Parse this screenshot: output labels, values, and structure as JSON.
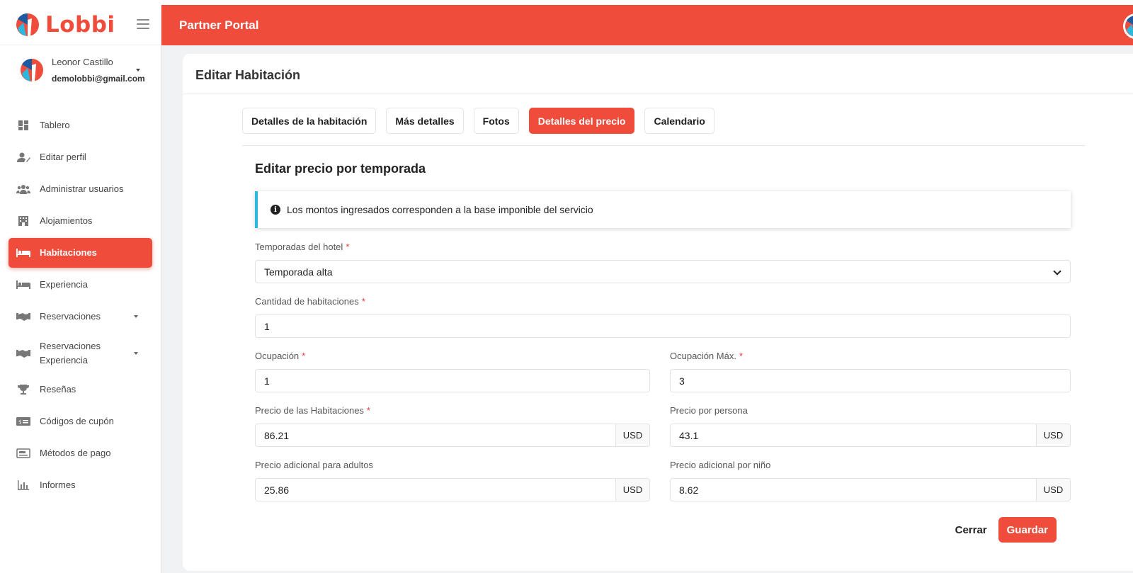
{
  "app": {
    "brand_name": "Lobbi",
    "header_title": "Partner Portal",
    "colors": {
      "brand": "#f04c3c",
      "alert_border": "#2bb9e0"
    }
  },
  "user": {
    "name": "Leonor Castillo",
    "email": "demolobbi@gmail.com"
  },
  "sidebar": {
    "items": [
      {
        "label": "Tablero",
        "icon": "dashboard-icon"
      },
      {
        "label": "Editar perfil",
        "icon": "user-edit-icon"
      },
      {
        "label": "Administrar usuarios",
        "icon": "users-icon"
      },
      {
        "label": "Alojamientos",
        "icon": "building-icon"
      },
      {
        "label": "Habitaciones",
        "icon": "bed-icon",
        "active": true
      },
      {
        "label": "Experiencia",
        "icon": "bed-icon"
      },
      {
        "label": "Reservaciones",
        "icon": "handshake-icon",
        "has_submenu": true
      },
      {
        "label": "Reservaciones Experiencia",
        "icon": "handshake-icon",
        "has_submenu": true
      },
      {
        "label": "Reseñas",
        "icon": "trophy-icon"
      },
      {
        "label": "Códigos de cupón",
        "icon": "coupon-icon"
      },
      {
        "label": "Métodos de pago",
        "icon": "payment-icon"
      },
      {
        "label": "Informes",
        "icon": "chart-icon"
      }
    ]
  },
  "page": {
    "title": "Editar Habitación",
    "tabs": [
      {
        "label": "Detalles de la habitación"
      },
      {
        "label": "Más detalles"
      },
      {
        "label": "Fotos"
      },
      {
        "label": "Detalles del precio",
        "active": true
      },
      {
        "label": "Calendario"
      }
    ]
  },
  "form": {
    "heading": "Editar precio por temporada",
    "alert": "Los montos ingresados corresponden a la base imponible del servicio",
    "season": {
      "label": "Temporadas del hotel",
      "value": "Temporada alta"
    },
    "rooms_qty": {
      "label": "Cantidad de habitaciones",
      "value": "1"
    },
    "occupancy": {
      "label": "Ocupación",
      "value": "1"
    },
    "max_occupancy": {
      "label": "Ocupación Máx.",
      "value": "3"
    },
    "room_price": {
      "label": "Precio de las Habitaciones",
      "value": "86.21",
      "currency": "USD"
    },
    "price_per_person": {
      "label": "Precio por persona",
      "value": "43.1",
      "currency": "USD"
    },
    "adult_extra": {
      "label": "Precio adicional para adultos",
      "value": "25.86",
      "currency": "USD"
    },
    "child_extra": {
      "label": "Precio adicional por niño",
      "value": "8.62",
      "currency": "USD"
    },
    "required_mark": "*",
    "close_label": "Cerrar",
    "save_label": "Guardar"
  }
}
